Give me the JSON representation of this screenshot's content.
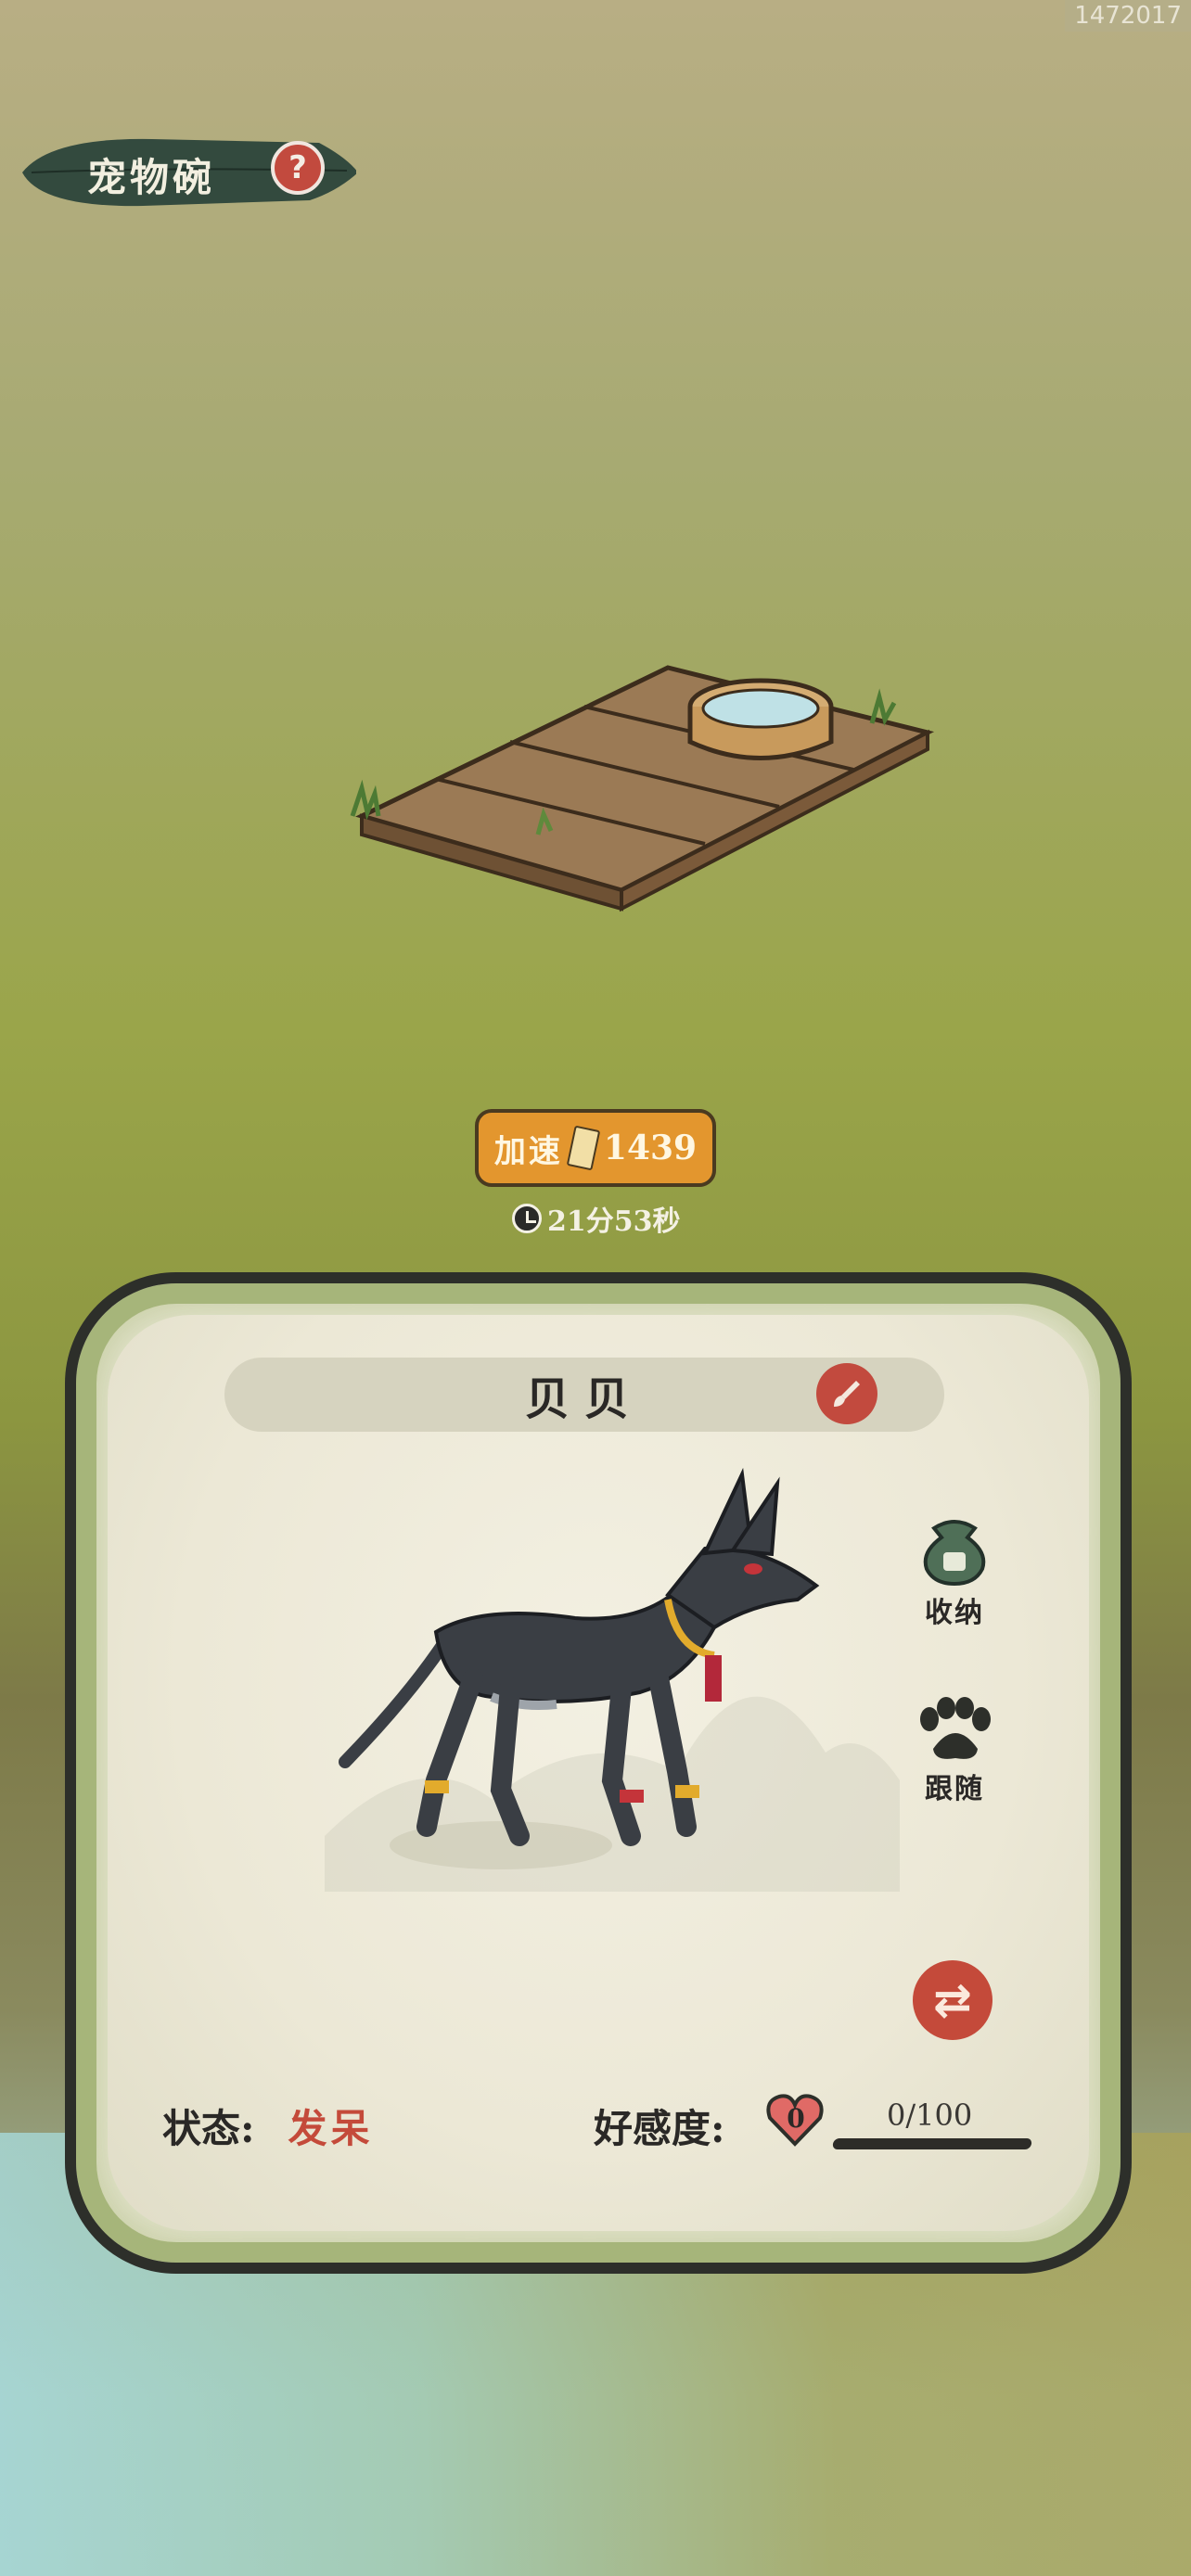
{
  "watermark": "1472017",
  "header": {
    "title": "宠物碗"
  },
  "speed_up": {
    "label": "加速",
    "cost": "1439",
    "timer": "21分53秒"
  },
  "pet": {
    "name": "贝贝",
    "actions": [
      {
        "label": "收纳",
        "icon": "pouch-icon"
      },
      {
        "label": "跟随",
        "icon": "paw-icon"
      }
    ],
    "status_label": "状态:",
    "status_value": "发呆",
    "affection_label": "好感度:",
    "affection_level": "0",
    "affection_count": "0/100",
    "affection_fraction": 0
  },
  "colors": {
    "accent_red": "#c24a3e",
    "speed_orange": "#e3962e",
    "panel_border": "#a6b57a"
  }
}
